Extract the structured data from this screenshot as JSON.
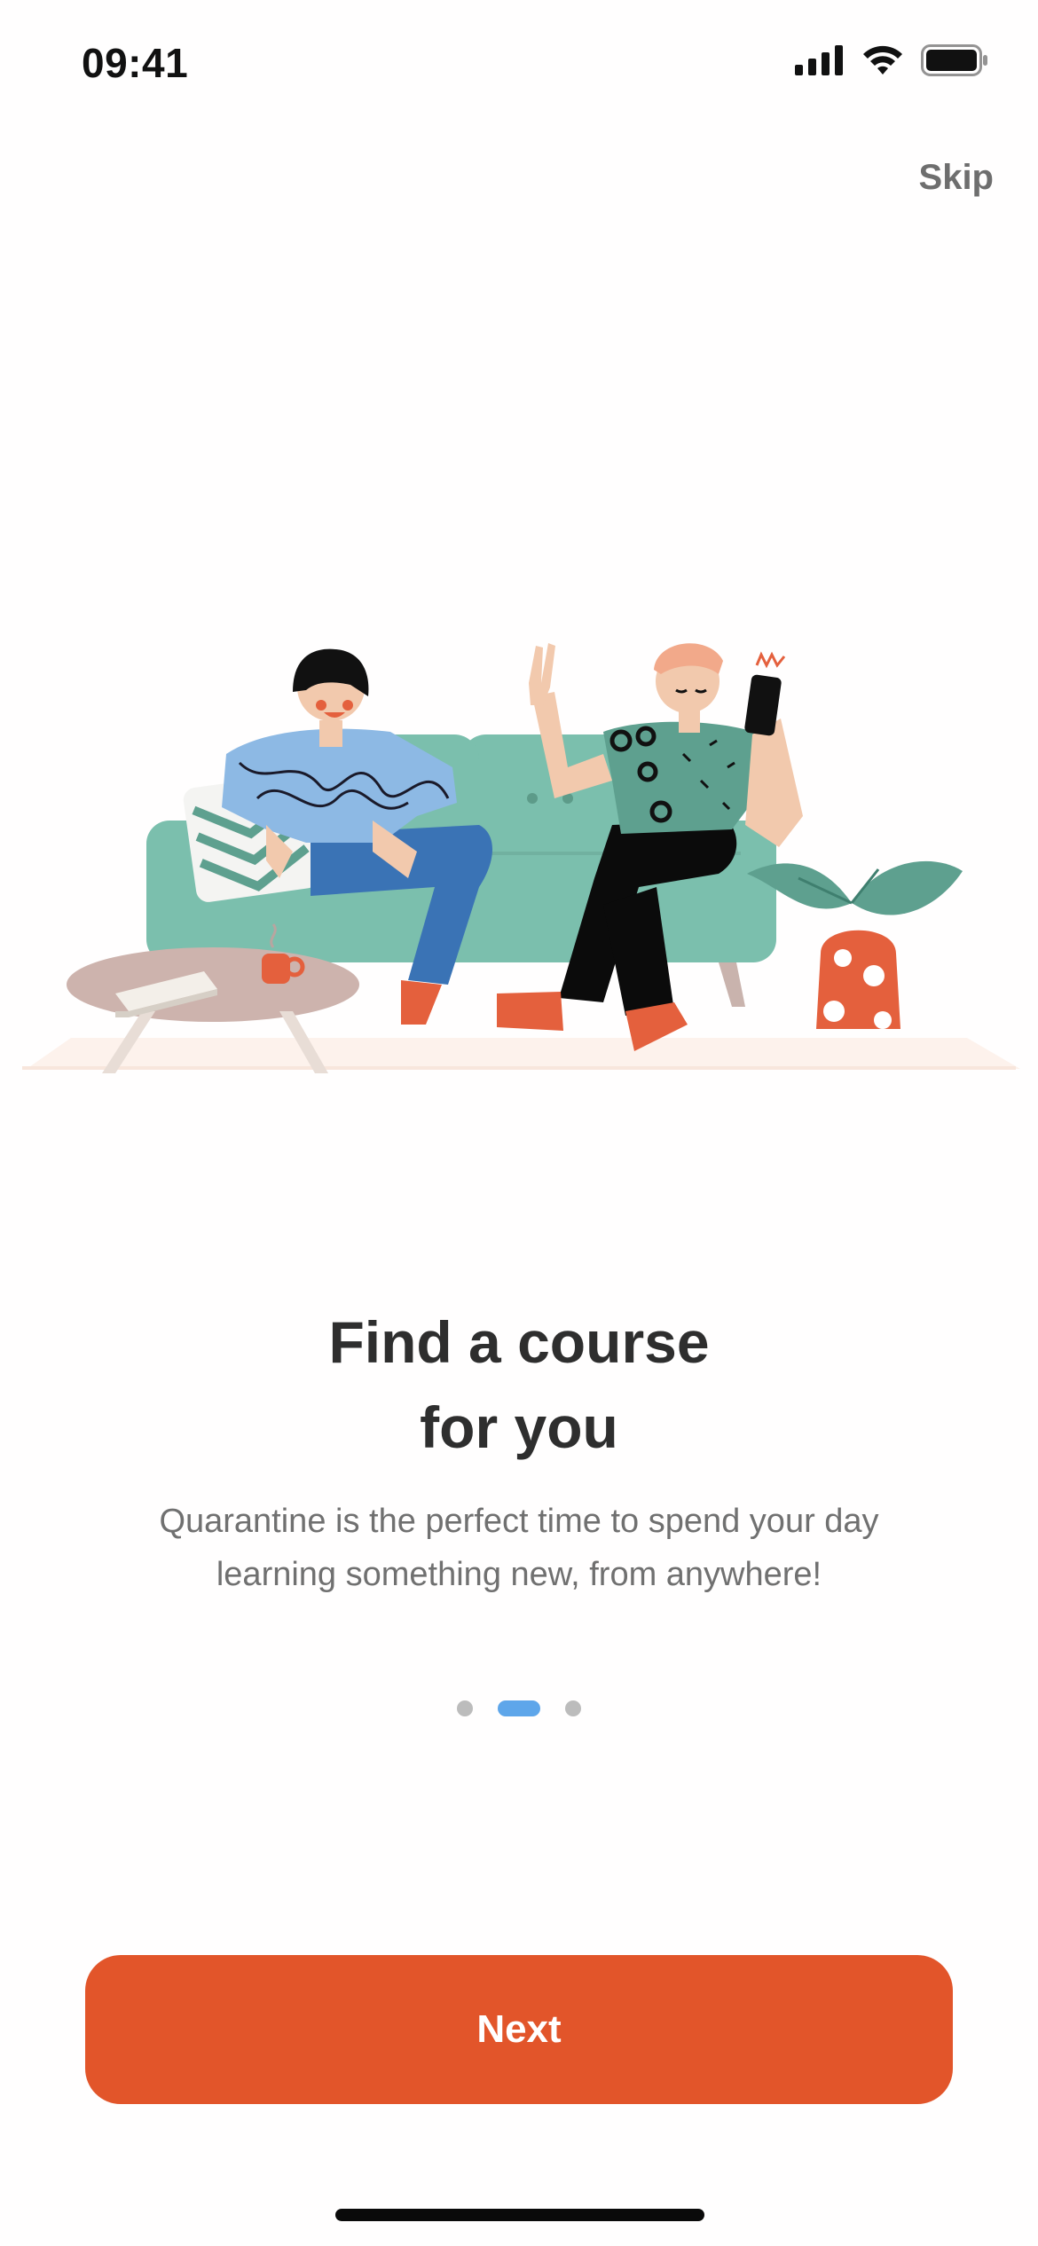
{
  "status_bar": {
    "time": "09:41",
    "icons": [
      "cellular-signal-icon",
      "wifi-icon",
      "battery-icon"
    ]
  },
  "header": {
    "skip_label": "Skip"
  },
  "illustration": {
    "name": "two-people-on-sofa-illustration"
  },
  "content": {
    "title_line1": "Find a course",
    "title_line2": "for you",
    "subtitle": "Quarantine is the perfect time to spend your day learning something new, from anywhere!"
  },
  "pagination": {
    "total": 3,
    "active_index": 1
  },
  "actions": {
    "next_label": "Next"
  },
  "colors": {
    "primary": "#e2552a",
    "dot_active": "#5ea6ea",
    "dot_inactive": "#bcbcbc",
    "title_text": "#2e2e2e",
    "body_text": "#707070"
  }
}
